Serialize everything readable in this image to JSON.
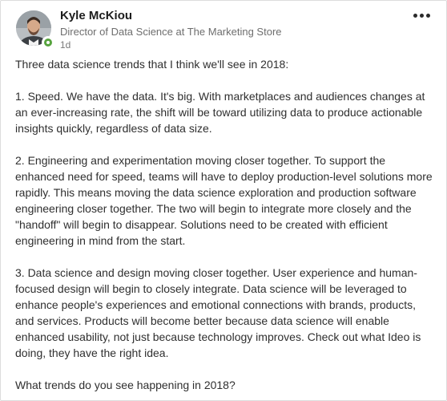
{
  "post": {
    "author": {
      "name": "Kyle McKiou",
      "headline": "Director of Data Science at The Marketing Store",
      "time": "1d",
      "online_status_color": "#57a33f"
    },
    "more_icon": "more-horizontal-icon",
    "paragraphs": [
      "Three data science trends that I think we'll see in 2018:",
      "1. Speed.  We have the data.  It's big.  With marketplaces and audiences changes at an ever-increasing rate, the shift will be toward utilizing data to produce actionable insights quickly, regardless of data size.",
      "2. Engineering and experimentation moving closer together.  To support the enhanced need for speed, teams will have to deploy production-level solutions more rapidly.  This means moving the data science exploration and production software engineering closer together.  The two will begin to integrate more closely and the \"handoff\" will begin to disappear.  Solutions need to be created with efficient engineering in mind from the start.",
      "3. Data science and design moving closer together.  User experience and human-focused design will begin to closely integrate.  Data science will be leveraged to enhance people's experiences and emotional connections with brands, products, and services.  Products will become better because data science will enable enhanced usability, not just because technology improves.  Check out what Ideo is doing, they have the right idea.",
      "What trends do you see happening in 2018?"
    ]
  }
}
